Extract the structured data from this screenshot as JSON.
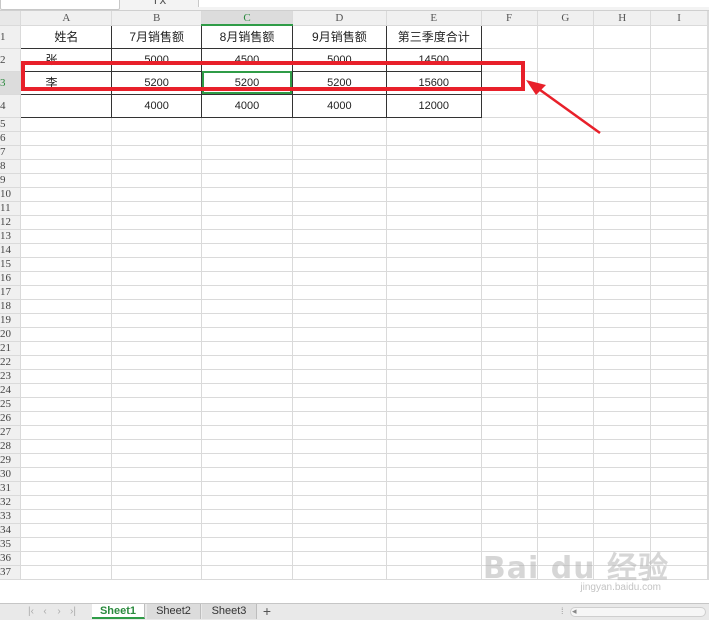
{
  "columns": [
    "A",
    "B",
    "C",
    "D",
    "E",
    "F",
    "G",
    "H",
    "I"
  ],
  "active_column": "C",
  "active_row": 3,
  "rows": [
    {
      "num": "1",
      "cells": [
        "姓名",
        "7月销售额",
        "8月销售额",
        "9月销售额",
        "第三季度合计"
      ]
    },
    {
      "num": "2",
      "cells": [
        "张",
        "5000",
        "4500",
        "5000",
        "14500"
      ]
    },
    {
      "num": "3",
      "cells": [
        "李",
        "5200",
        "5200",
        "5200",
        "15600"
      ]
    },
    {
      "num": "4",
      "cells": [
        "",
        "4000",
        "4000",
        "4000",
        "12000"
      ]
    }
  ],
  "empty_rows": [
    "5",
    "6",
    "7",
    "8",
    "9",
    "10",
    "11",
    "12",
    "13",
    "14",
    "15",
    "16",
    "17",
    "18",
    "19",
    "20",
    "21",
    "22",
    "23",
    "24",
    "25",
    "26",
    "27",
    "28",
    "29",
    "30",
    "31",
    "32",
    "33",
    "34",
    "35",
    "36",
    "37"
  ],
  "sheet_tabs": [
    {
      "label": "Sheet1",
      "active": true
    },
    {
      "label": "Sheet2",
      "active": false
    },
    {
      "label": "Sheet3",
      "active": false
    }
  ],
  "add_sheet_label": "+",
  "watermark": {
    "text": "Bai du 经验",
    "url": "jingyan.baidu.com"
  },
  "colors": {
    "accent_green": "#2f9c47",
    "highlight_red": "#e8202a"
  },
  "icons": {
    "add_sheet": "plus-icon",
    "annotation": "red-arrow-icon"
  }
}
